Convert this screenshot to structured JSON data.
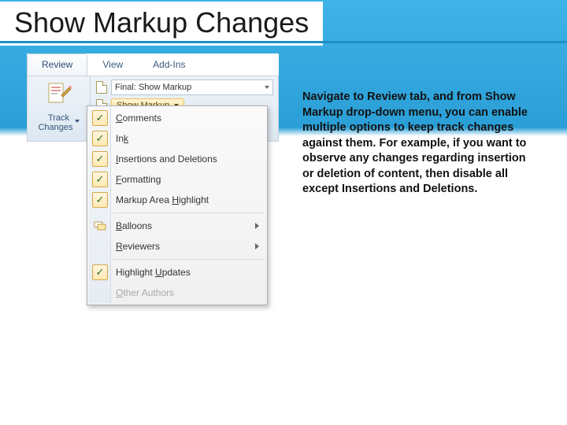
{
  "slide": {
    "title": "Show Markup Changes",
    "description": "Navigate to Review tab, and from Show Markup drop-down menu, you can enable multiple options to keep track changes against them. For example, if you want to observe any changes regarding insertion or deletion of content, then disable all except Insertions and Deletions."
  },
  "ribbon": {
    "tabs": [
      "Review",
      "View",
      "Add-Ins"
    ],
    "active_tab": "Review",
    "track_changes_label_line1": "Track",
    "track_changes_label_line2": "Changes",
    "display_mode": "Final: Show Markup",
    "show_markup_label": "Show Markup"
  },
  "menu": {
    "items": [
      {
        "label": "Comments",
        "ul": "C",
        "checked": true,
        "submenu": false
      },
      {
        "label": "Ink",
        "ul": "k",
        "checked": true,
        "submenu": false
      },
      {
        "label": "Insertions and Deletions",
        "ul": "I",
        "checked": true,
        "submenu": false
      },
      {
        "label": "Formatting",
        "ul": "F",
        "checked": true,
        "submenu": false
      },
      {
        "label": "Markup Area Highlight",
        "ul": "H",
        "checked": true,
        "submenu": false
      }
    ],
    "sub_items": [
      {
        "label": "Balloons",
        "ul": "B",
        "icon": "balloons-icon",
        "submenu": true
      },
      {
        "label": "Reviewers",
        "ul": "R",
        "icon": null,
        "submenu": true
      }
    ],
    "footer_items": [
      {
        "label": "Highlight Updates",
        "ul": "U",
        "checked": true,
        "disabled": false
      },
      {
        "label": "Other Authors",
        "ul": "O",
        "checked": false,
        "disabled": true
      }
    ]
  }
}
